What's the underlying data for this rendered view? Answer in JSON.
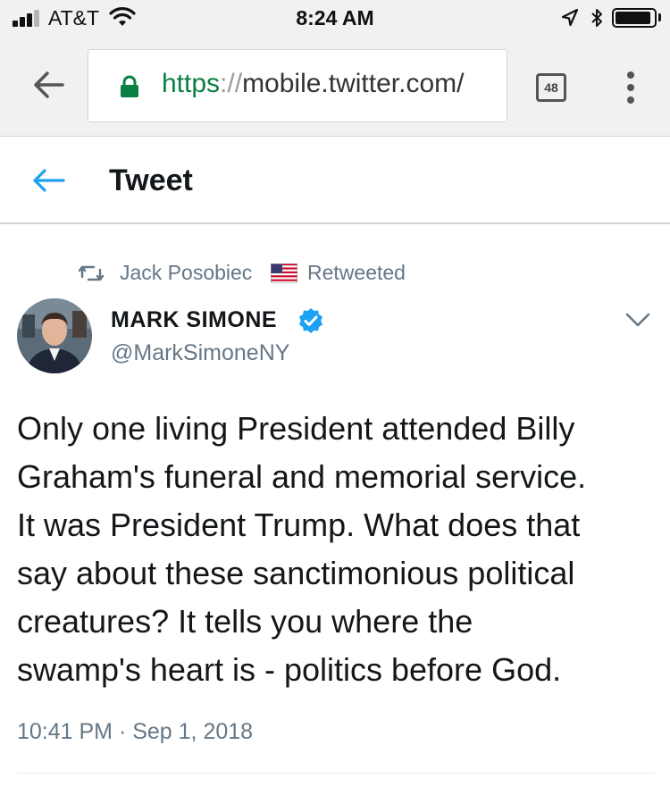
{
  "status_bar": {
    "carrier": "AT&T",
    "time": "8:24 AM",
    "battery_level": 0.85
  },
  "browser": {
    "url_scheme": "https",
    "url_separator": "://",
    "url_host": "mobile.twitter.com/",
    "tab_count": "48",
    "lock_color": "#0b8043"
  },
  "header": {
    "title": "Tweet",
    "accent_color": "#1da1f2"
  },
  "tweet": {
    "retweeted_by": "Jack Posobiec",
    "retweeted_suffix": "Retweeted",
    "display_name": "MARK SIMONE",
    "handle": "@MarkSimoneNY",
    "text_lines": [
      "Only one living President attended Billy",
      "Graham's funeral and memorial service.",
      "It was President Trump. What does that",
      "say about these sanctimonious political",
      "creatures?  It tells you where the",
      "swamp's heart is - politics before God."
    ],
    "timestamp": "10:41 PM · Sep 1, 2018"
  },
  "icons": {
    "signal": "signal-bars-icon",
    "wifi": "wifi-icon",
    "location": "location-arrow-icon",
    "bluetooth": "bluetooth-icon",
    "battery": "battery-icon",
    "browser_back": "back-arrow-icon",
    "lock": "lock-icon",
    "tabs": "tab-switcher-icon",
    "menu": "overflow-menu-icon",
    "twitter_back": "back-arrow-icon",
    "retweet": "retweet-icon",
    "flag": "us-flag-icon",
    "verified": "verified-badge-icon",
    "caret": "chevron-down-icon"
  }
}
